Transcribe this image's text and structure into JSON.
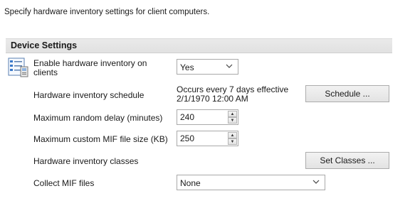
{
  "description": "Specify hardware inventory settings for client computers.",
  "section": {
    "title": "Device Settings"
  },
  "settings": {
    "enable": {
      "label_line1": "Enable hardware inventory on",
      "label_line2": "clients",
      "value": "Yes"
    },
    "schedule": {
      "label": "Hardware inventory schedule",
      "text_line1": "Occurs every 7 days effective",
      "text_line2": "2/1/1970 12:00 AM",
      "button": "Schedule ..."
    },
    "max_delay": {
      "label": "Maximum random delay (minutes)",
      "value": "240"
    },
    "max_mif": {
      "label": "Maximum custom MIF file size (KB)",
      "value": "250"
    },
    "classes": {
      "label": "Hardware inventory classes",
      "button": "Set Classes ..."
    },
    "collect_mif": {
      "label": "Collect MIF files",
      "value": "None"
    }
  },
  "icons": {
    "settings": "settings-list-icon",
    "dropdown": "chevron-down-icon",
    "spin_up": "spin-up-icon",
    "spin_down": "spin-down-icon"
  }
}
